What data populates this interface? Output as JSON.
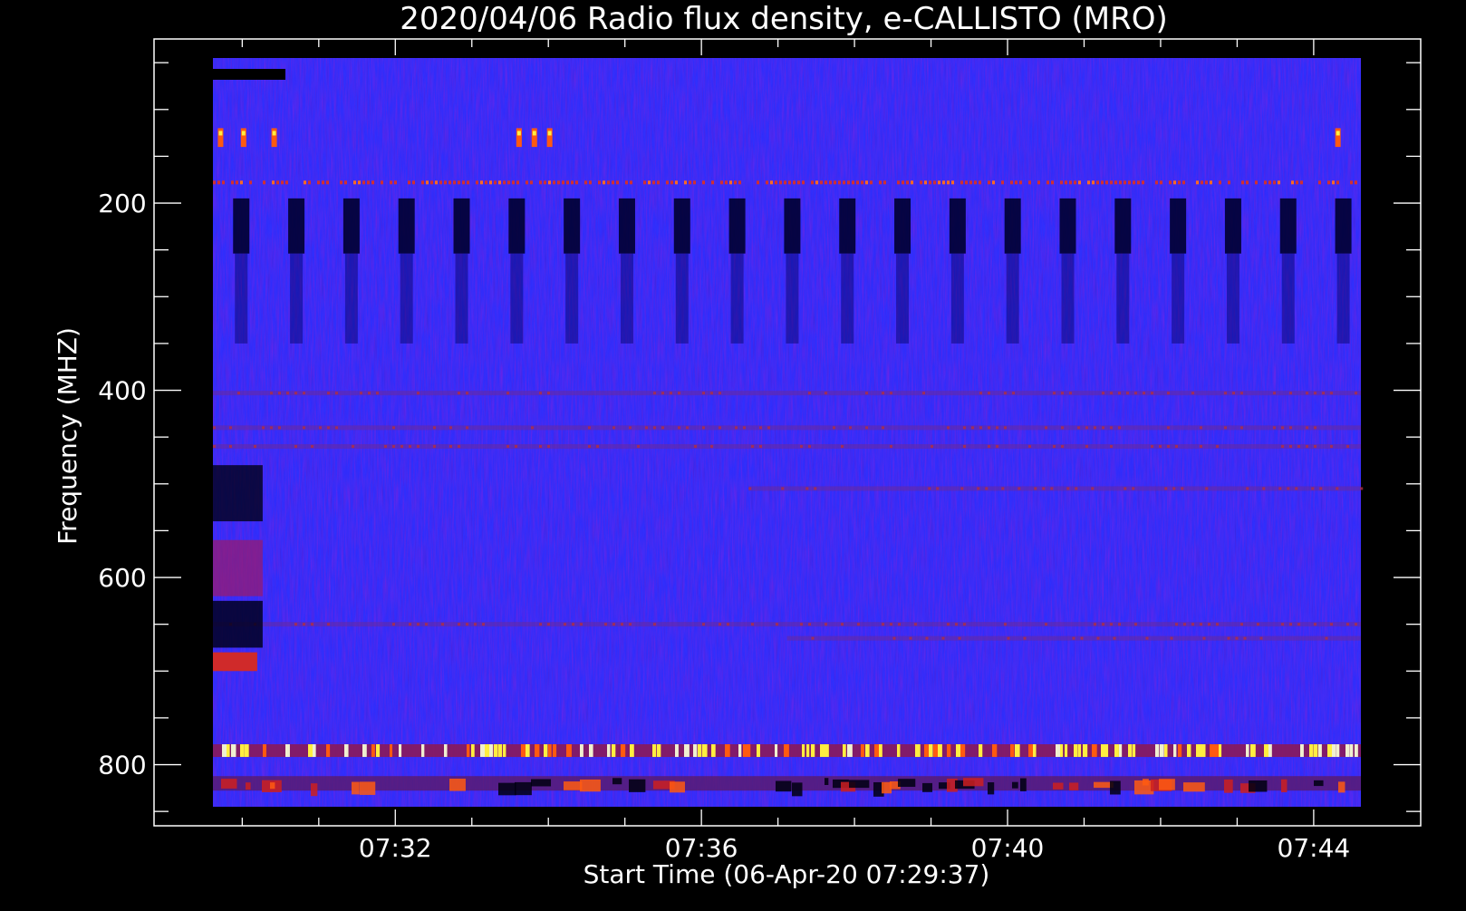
{
  "chart_data": {
    "type": "heatmap",
    "title": "2020/04/06  Radio flux density, e-CALLISTO (MRO)",
    "xlabel": "Start Time (06-Apr-20 07:29:37)",
    "ylabel": "Frequency (MHZ)",
    "x_axis": {
      "unit": "minutes since 07:29:37 UT",
      "range": [
        0,
        15
      ],
      "tick_labels": [
        "07:32",
        "07:36",
        "07:40",
        "07:44"
      ],
      "major_tick_values": [
        2.383,
        6.383,
        10.383,
        14.383
      ]
    },
    "y_axis": {
      "unit": "MHz",
      "range": [
        45,
        870
      ],
      "reversed": true,
      "tick_labels": [
        "200",
        "400",
        "600",
        "800"
      ],
      "major_tick_values": [
        200,
        400,
        600,
        800
      ],
      "minor_tick_values": [
        50,
        100,
        150,
        250,
        300,
        350,
        450,
        500,
        550,
        650,
        700,
        750,
        850
      ]
    },
    "data_extent": {
      "time_minutes": [
        0,
        15
      ],
      "frequency_mhz": [
        45,
        845
      ]
    },
    "colormap": [
      "#000000",
      "#1a1aff",
      "#3333ff",
      "#8a2a8a",
      "#cc2020",
      "#ff5a10",
      "#ffee40"
    ],
    "background_value": "#2a2af0",
    "features": [
      {
        "kind": "horizontal band",
        "freq_mhz": 178,
        "t_range": [
          0,
          15
        ],
        "intensity": "moderate (red dotted)"
      },
      {
        "kind": "horizontal band",
        "freq_mhz": 403,
        "t_range": [
          0,
          15
        ],
        "intensity": "weak"
      },
      {
        "kind": "horizontal band",
        "freq_mhz": 440,
        "t_range": [
          0,
          15
        ],
        "intensity": "weak"
      },
      {
        "kind": "horizontal band",
        "freq_mhz": 460,
        "t_range": [
          0,
          15
        ],
        "intensity": "weak"
      },
      {
        "kind": "horizontal band",
        "freq_mhz": 505,
        "t_range": [
          7,
          15
        ],
        "intensity": "weak"
      },
      {
        "kind": "horizontal band",
        "freq_mhz": 650,
        "t_range": [
          0,
          15
        ],
        "intensity": "weak"
      },
      {
        "kind": "horizontal band",
        "freq_mhz": 665,
        "t_range": [
          7.5,
          15
        ],
        "intensity": "weak"
      },
      {
        "kind": "horizontal band",
        "freq_mhz": 785,
        "t_range": [
          0,
          15
        ],
        "intensity": "strong (yellow spikes)"
      },
      {
        "kind": "horizontal band",
        "freq_mhz": 820,
        "t_range": [
          0,
          15
        ],
        "intensity": "moderate (red patches)"
      },
      {
        "kind": "periodic dark stripes",
        "freq_range_mhz": [
          195,
          350
        ],
        "period_minutes": 0.72,
        "t_range": [
          0,
          15
        ]
      },
      {
        "kind": "local bursts",
        "freq_range_mhz": [
          120,
          140
        ],
        "t_values": [
          0.1,
          0.4,
          0.8,
          4.0,
          4.2,
          4.4,
          14.7
        ]
      },
      {
        "kind": "interference block",
        "freq_range_mhz": [
          45,
          720
        ],
        "t_range": [
          0,
          0.65
        ]
      }
    ]
  }
}
